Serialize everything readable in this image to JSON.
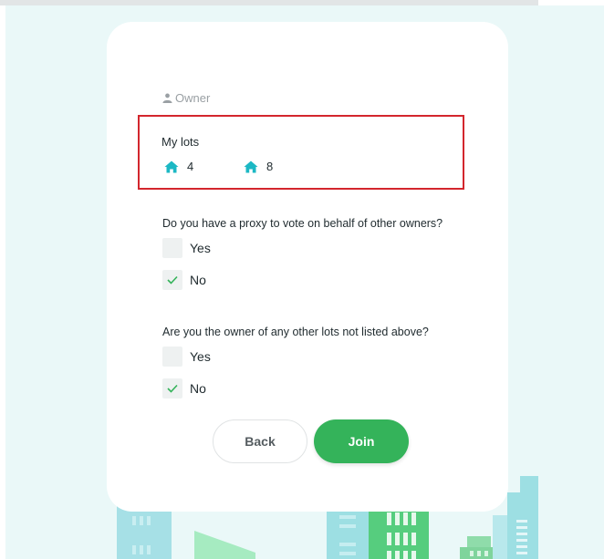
{
  "form": {
    "role_label": "Owner",
    "lots_title": "My lots",
    "lots": [
      {
        "number": "4"
      },
      {
        "number": "8"
      }
    ],
    "question_proxy": "Do you have a proxy to vote on behalf of other owners?",
    "question_other_lots": "Are you the owner of any other lots not listed above?",
    "proxy_options": [
      {
        "label": "Yes",
        "checked": false
      },
      {
        "label": "No",
        "checked": true
      }
    ],
    "other_lots_options": [
      {
        "label": "Yes",
        "checked": false
      },
      {
        "label": "No",
        "checked": true
      }
    ],
    "back_label": "Back",
    "join_label": "Join"
  },
  "colors": {
    "accent_green": "#34b35a",
    "house_icon": "#1cb8c4",
    "highlight_border": "#d3262d",
    "background": "#eaf8f8"
  }
}
